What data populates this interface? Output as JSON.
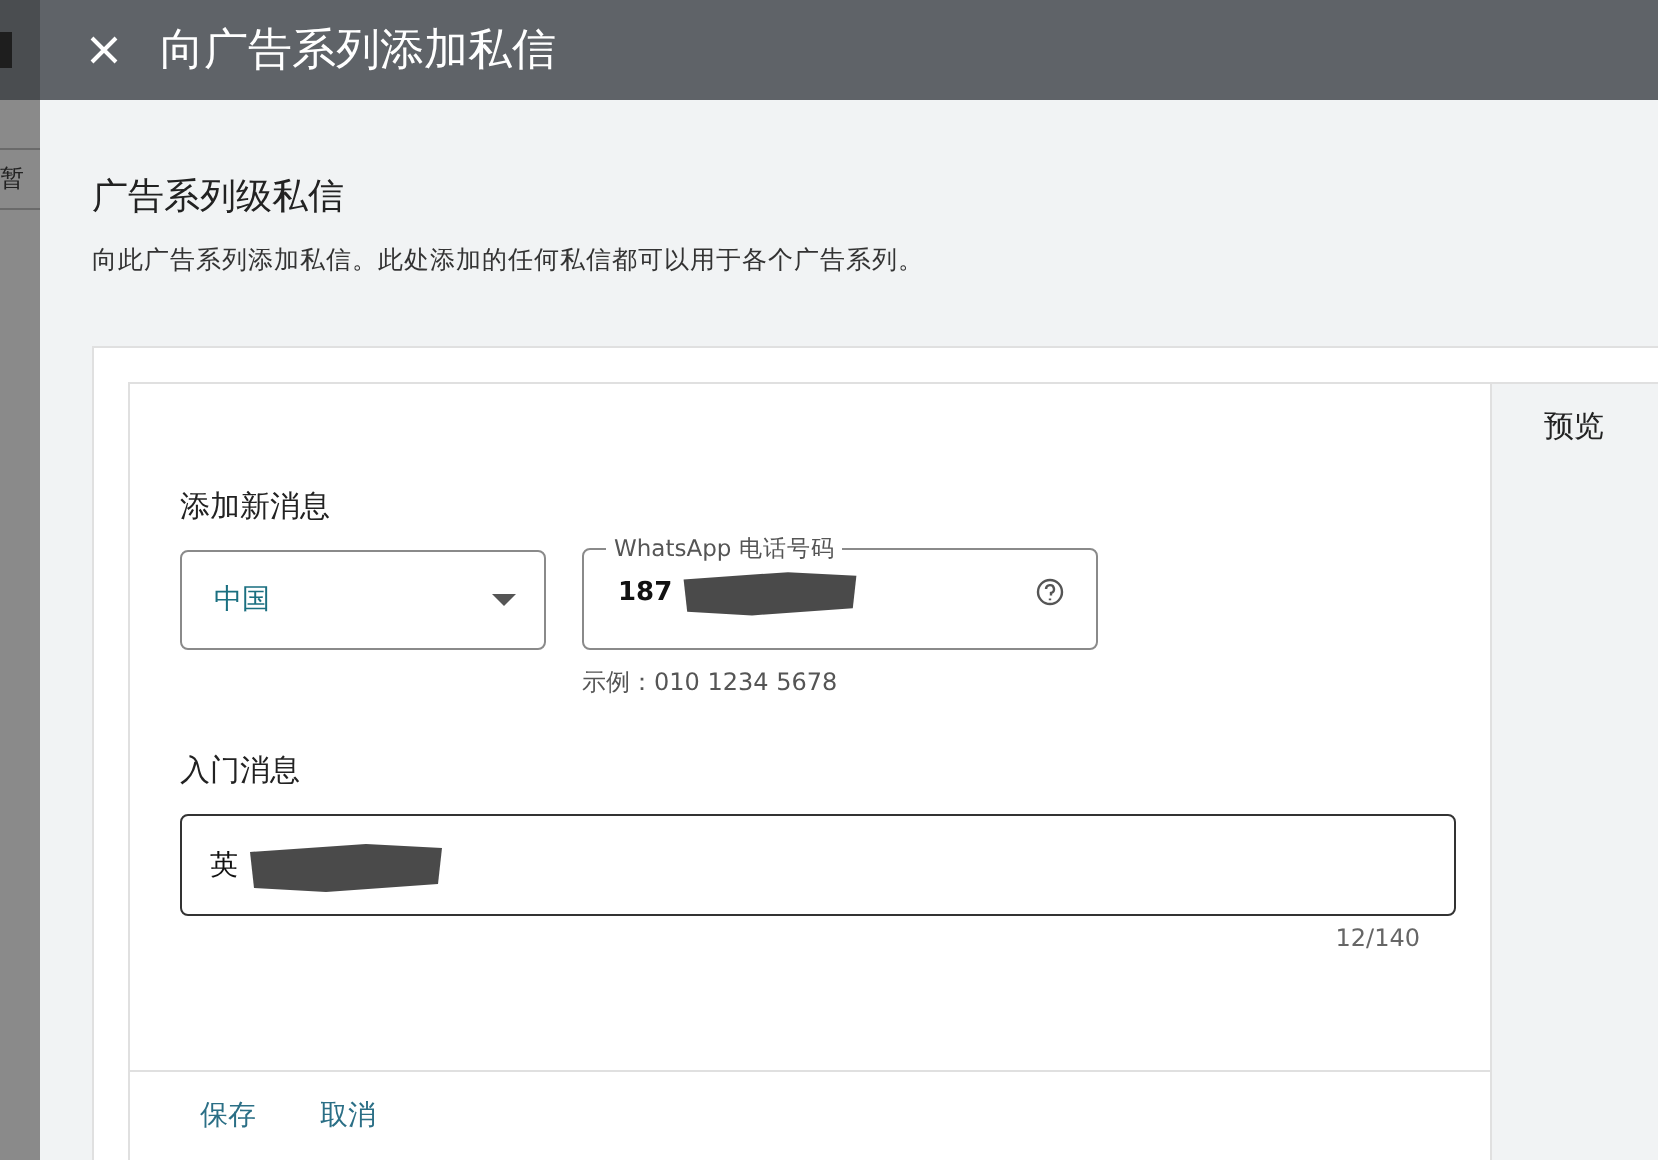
{
  "backdrop": {
    "fragment": "暂"
  },
  "dialog": {
    "title": "向广告系列添加私信"
  },
  "section": {
    "title": "广告系列级私信",
    "description": "向此广告系列添加私信。此处添加的任何私信都可以用于各个广告系列。"
  },
  "form": {
    "heading": "添加新消息",
    "country": {
      "value": "中国"
    },
    "phone": {
      "label": "WhatsApp 电话号码",
      "value": "187",
      "redacted": true,
      "helper": "示例：010 1234 5678"
    },
    "message": {
      "label": "入门消息",
      "value": "英",
      "redacted": true,
      "counter": "12/140"
    },
    "buttons": [
      "保存",
      "取消"
    ]
  },
  "preview": {
    "title": "预览"
  }
}
